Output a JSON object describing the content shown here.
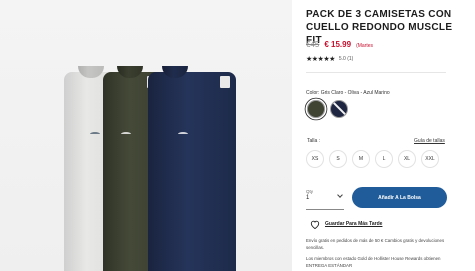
{
  "product": {
    "title": "PACK DE 3 CAMISETAS CON CUELLO REDONDO MUSCLE FIT",
    "price_old": "€45",
    "price_new": "€ 15.99",
    "price_note": "(Martes",
    "stars": "★★★★★",
    "rating": "5.0 (1)"
  },
  "color": {
    "label": "Color: Gris Claro - Oliva - Azul Marino",
    "swatches": [
      {
        "name": "Oliva",
        "hex": "#3f4433",
        "selected": true
      },
      {
        "name": "Azul Marino",
        "hex": "#1e2642",
        "selected": false
      }
    ]
  },
  "size": {
    "label": "Talla :",
    "guide_link": "Guía de tallas",
    "options": [
      "XS",
      "S",
      "M",
      "L",
      "XL",
      "XXL"
    ]
  },
  "quantity": {
    "label": "Qty",
    "value": "1"
  },
  "actions": {
    "add_to_bag": "Añadir A La Bolsa",
    "save_later": "Guardar Para Más Tarde"
  },
  "notes": {
    "shipping": "Envío gratis en pedidos de más de 50 € Cambios gratis y devoluciones sencillas.",
    "members": "Los miembros con estado Gold de Hollister House Rewards obtienen ENTREGA ESTÁNDAR"
  },
  "colors": {
    "accent": "#1f5c99",
    "sale": "#c8102e"
  }
}
